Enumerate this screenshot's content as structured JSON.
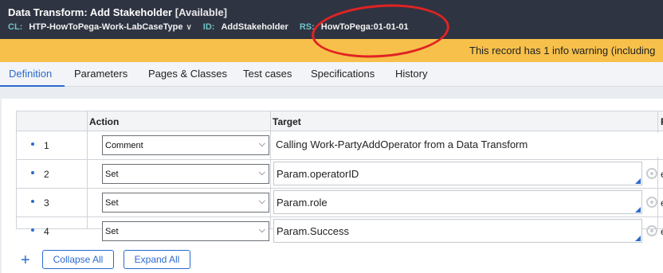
{
  "header": {
    "title": "Data Transform: Add Stakeholder",
    "status": "[Available]",
    "class_key": "CL:",
    "class_value": "HTP-HowToPega-Work-LabCaseType",
    "id_key": "ID:",
    "id_value": "AddStakeholder",
    "ruleset_key": "RS:",
    "ruleset_value": "HowToPega:01-01-01"
  },
  "warning": {
    "text": "This record has 1 info warning (including"
  },
  "tabs": [
    {
      "label": "Definition",
      "active": true
    },
    {
      "label": "Parameters"
    },
    {
      "label": "Pages & Classes"
    },
    {
      "label": "Test cases"
    },
    {
      "label": "Specifications"
    },
    {
      "label": "History"
    }
  ],
  "grid": {
    "columns": [
      "Action",
      "Target",
      "R"
    ],
    "rows": [
      {
        "num": "1",
        "action": "Comment",
        "target": "Calling Work-PartyAddOperator from a Data Transform",
        "trail": ""
      },
      {
        "num": "2",
        "action": "Set",
        "target": "Param.operatorID",
        "trail": "e"
      },
      {
        "num": "3",
        "action": "Set",
        "target": "Param.role",
        "trail": "e"
      },
      {
        "num": "4",
        "action": "Set",
        "target": "Param.Success",
        "trail": "e"
      }
    ]
  },
  "buttons": {
    "add": "+",
    "collapse": "Collapse All",
    "expand": "Expand All"
  },
  "icons": {
    "dropdown": "chevron-down-icon",
    "select_arrow": "select-arrow-icon",
    "gear": "gear-icon",
    "add": "plus-icon"
  },
  "colors": {
    "header_bg": "#2f3442",
    "warning_bg": "#f7c04a",
    "accent": "#2b6ad0",
    "annotation": "#e12323"
  }
}
